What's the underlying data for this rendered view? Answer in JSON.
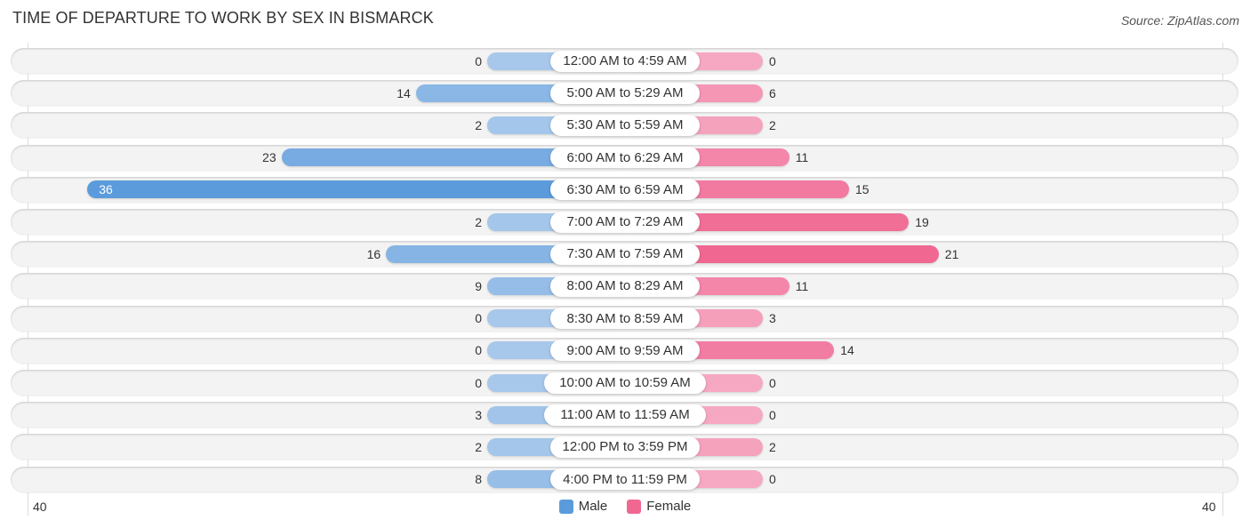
{
  "title": "TIME OF DEPARTURE TO WORK BY SEX IN BISMARCK",
  "source": "Source: ZipAtlas.com",
  "colors": {
    "male": "#5b9bdb",
    "male_light": "#a8c8eb",
    "female": "#f06892",
    "female_light": "#f6a8c2"
  },
  "chart_data": {
    "type": "bar",
    "orientation": "horizontal-diverging",
    "title": "TIME OF DEPARTURE TO WORK BY SEX IN BISMARCK",
    "categories": [
      "12:00 AM to 4:59 AM",
      "5:00 AM to 5:29 AM",
      "5:30 AM to 5:59 AM",
      "6:00 AM to 6:29 AM",
      "6:30 AM to 6:59 AM",
      "7:00 AM to 7:29 AM",
      "7:30 AM to 7:59 AM",
      "8:00 AM to 8:29 AM",
      "8:30 AM to 8:59 AM",
      "9:00 AM to 9:59 AM",
      "10:00 AM to 10:59 AM",
      "11:00 AM to 11:59 AM",
      "12:00 PM to 3:59 PM",
      "4:00 PM to 11:59 PM"
    ],
    "series": [
      {
        "name": "Male",
        "side": "left",
        "values": [
          0,
          14,
          2,
          23,
          36,
          2,
          16,
          9,
          0,
          0,
          0,
          3,
          2,
          8
        ]
      },
      {
        "name": "Female",
        "side": "right",
        "values": [
          0,
          6,
          2,
          11,
          15,
          19,
          21,
          11,
          3,
          14,
          0,
          0,
          2,
          0
        ]
      }
    ],
    "xlim": [
      -40,
      40
    ],
    "tick_labels": {
      "left": "40",
      "right": "40"
    },
    "legend": {
      "entries": [
        "Male",
        "Female"
      ],
      "placement": "bottom-center"
    },
    "grid": false
  }
}
